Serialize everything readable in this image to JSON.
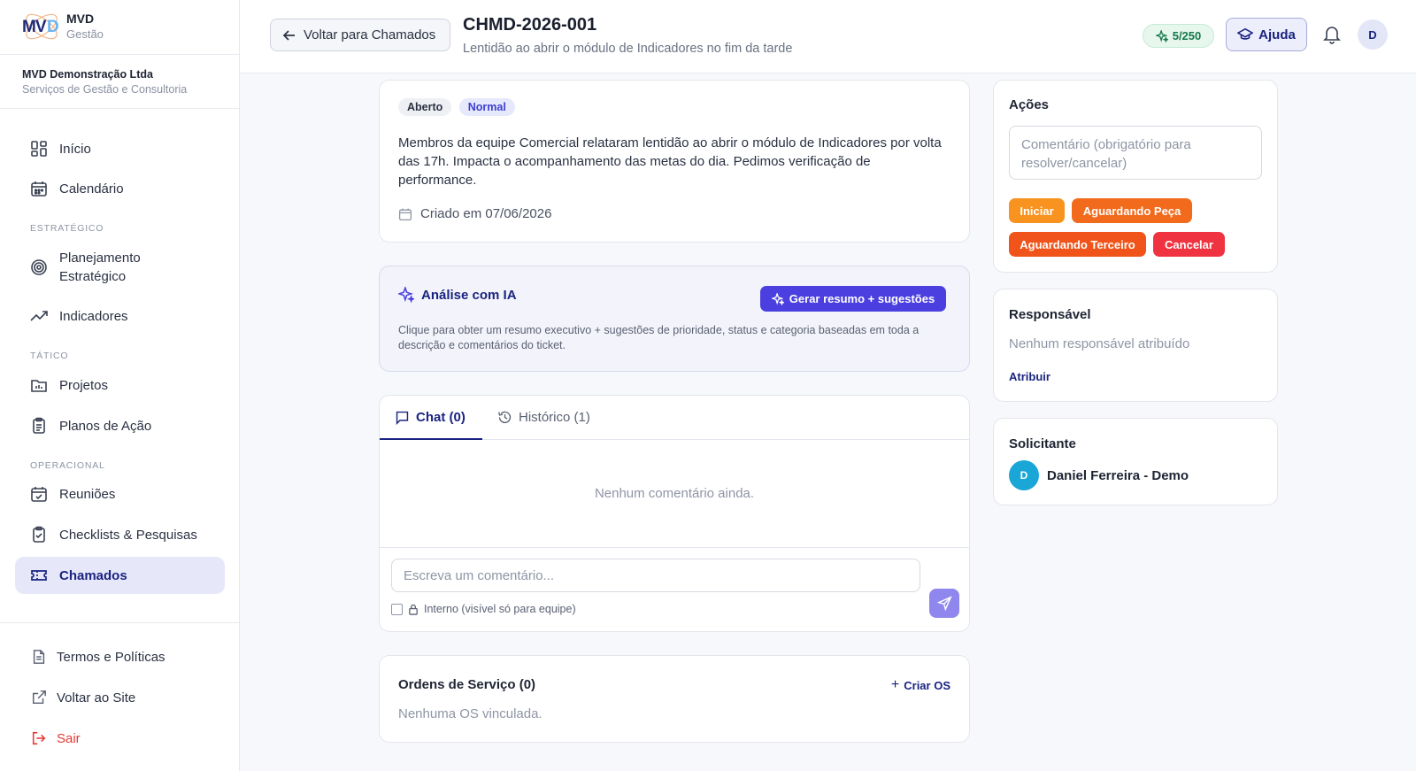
{
  "brand": {
    "name": "MVD",
    "sub": "Gestão",
    "logo_text_1": "MV",
    "logo_text_2": "D"
  },
  "company": {
    "name": "MVD Demonstração Ltda",
    "sub": "Serviços de Gestão e Consultoria"
  },
  "nav": {
    "items": [
      {
        "label": "Início",
        "icon": "dashboard-icon"
      },
      {
        "label": "Calendário",
        "icon": "calendar-icon"
      },
      {
        "label": "Planejamento Estratégico",
        "icon": "target-icon"
      },
      {
        "label": "Indicadores",
        "icon": "trending-up-icon"
      },
      {
        "label": "Projetos",
        "icon": "projects-icon"
      },
      {
        "label": "Planos de Ação",
        "icon": "clipboard-icon"
      },
      {
        "label": "Reuniões",
        "icon": "calendar-check-icon"
      },
      {
        "label": "Checklists & Pesquisas",
        "icon": "clipboard-check-icon"
      },
      {
        "label": "Chamados",
        "icon": "ticket-icon",
        "active": true
      }
    ],
    "sections": {
      "estrategico": "ESTRATÉGICO",
      "tatico": "TÁTICO",
      "operacional": "OPERACIONAL"
    },
    "bottom": [
      {
        "label": "Termos e Políticas",
        "icon": "document-icon"
      },
      {
        "label": "Voltar ao Site",
        "icon": "external-link-icon"
      },
      {
        "label": "Sair",
        "icon": "logout-icon"
      }
    ]
  },
  "header": {
    "back_label": "Voltar para Chamados",
    "title": "CHMD-2026-001",
    "subtitle": "Lentidão ao abrir o módulo de Indicadores no fim da tarde",
    "quota": "5/250",
    "help_label": "Ajuda",
    "avatar": "D"
  },
  "ticket": {
    "status": "Aberto",
    "priority": "Normal",
    "description": "Membros da equipe Comercial relataram lentidão ao abrir o módulo de Indicadores por volta das 17h. Impacta o acompanhamento das metas do dia. Pedimos verificação de performance.",
    "created": "Criado em 07/06/2026"
  },
  "ai": {
    "title": "Análise com IA",
    "button": "Gerar resumo + sugestões",
    "text": "Clique para obter um resumo executivo + sugestões de prioridade, status e categoria baseadas em toda a descrição e comentários do ticket."
  },
  "chat": {
    "tab_chat": "Chat (0)",
    "tab_history": "Histórico (1)",
    "empty": "Nenhum comentário ainda.",
    "placeholder": "Escreva um comentário...",
    "internal_label": "Interno (visível só para equipe)"
  },
  "orders": {
    "title": "Ordens de Serviço (0)",
    "create": "Criar OS",
    "empty": "Nenhuma OS vinculada."
  },
  "actions": {
    "title": "Ações",
    "placeholder": "Comentário (obrigatório para resolver/cancelar)",
    "buttons": [
      "Iniciar",
      "Aguardando Peça",
      "Aguardando Terceiro",
      "Cancelar"
    ]
  },
  "assignee": {
    "title": "Responsável",
    "empty": "Nenhum responsável atribuído",
    "assign": "Atribuir"
  },
  "requester": {
    "title": "Solicitante",
    "avatar": "D",
    "name": "Daniel Ferreira - Demo"
  },
  "colors": {
    "accent": "#4b3fe0",
    "brand_navy": "#1a2380",
    "iniciar": "#f7931e",
    "aguardando_peca": "#f26b1d",
    "aguardando_terceiro": "#f0541a",
    "cancelar": "#ef3340"
  }
}
